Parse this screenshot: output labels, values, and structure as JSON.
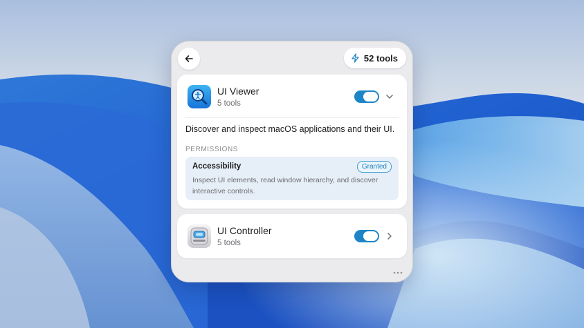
{
  "header": {
    "tools_count": "52 tools"
  },
  "extensions": [
    {
      "name": "UI Viewer",
      "subtitle": "5 tools",
      "enabled": true,
      "expanded": true,
      "description": "Discover and inspect macOS applications and their UI.",
      "permissions_heading": "PERMISSIONS",
      "permission": {
        "name": "Accessibility",
        "status": "Granted",
        "description": "Inspect UI elements, read window hierarchy, and discover interactive controls."
      }
    },
    {
      "name": "UI Controller",
      "subtitle": "5 tools",
      "enabled": true,
      "expanded": false
    }
  ],
  "colors": {
    "accent": "#1d85c7",
    "panel": "#ebebed",
    "permission_box": "#e6eef7"
  },
  "icons": [
    "back-arrow-icon",
    "bolt-icon",
    "ui-viewer-app-icon",
    "chevron-down-icon",
    "ui-controller-app-icon",
    "chevron-right-icon",
    "more-dots-icon"
  ]
}
